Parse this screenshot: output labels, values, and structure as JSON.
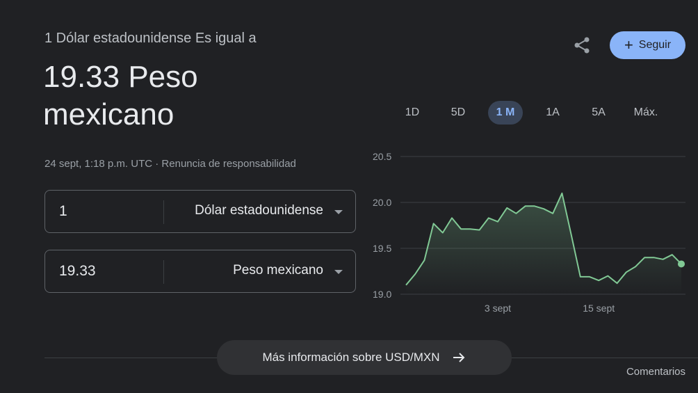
{
  "header": {
    "subtitle": "1 Dólar estadounidense Es igual a",
    "result": "19.33 Peso mexicano",
    "timestamp": "24 sept, 1:18 p.m. UTC",
    "separator": " · ",
    "disclaimer": "Renuncia de responsabilidad"
  },
  "actions": {
    "share_icon": "share-icon",
    "follow_label": "Seguir",
    "follow_icon": "+"
  },
  "converter": {
    "from": {
      "amount": "1",
      "currency": "Dólar estadounidense"
    },
    "to": {
      "amount": "19.33",
      "currency": "Peso mexicano"
    }
  },
  "ranges": [
    "1D",
    "5D",
    "1 M",
    "1A",
    "5A",
    "Máx."
  ],
  "active_range": "1 M",
  "colors": {
    "line": "#81c995",
    "accent": "#8ab4f8",
    "background": "#202124"
  },
  "chart_data": {
    "type": "area",
    "title": "",
    "xlabel": "",
    "ylabel": "",
    "y_ticks": [
      "20.5",
      "20.0",
      "19.5",
      "19.0"
    ],
    "ylim": [
      19.0,
      20.5
    ],
    "x_tick_labels": [
      {
        "label": "3 sept",
        "index": 10
      },
      {
        "label": "15 sept",
        "index": 21
      }
    ],
    "values": [
      19.1,
      19.22,
      19.37,
      19.77,
      19.67,
      19.83,
      19.71,
      19.71,
      19.7,
      19.83,
      19.79,
      19.94,
      19.88,
      19.96,
      19.96,
      19.93,
      19.88,
      20.1,
      19.65,
      19.19,
      19.19,
      19.15,
      19.2,
      19.12,
      19.24,
      19.3,
      19.4,
      19.4,
      19.38,
      19.43,
      19.33
    ],
    "grid": true
  },
  "footer": {
    "more_label": "Más información sobre USD/MXN",
    "more_icon": "arrow-right-icon",
    "feedback": "Comentarios"
  }
}
